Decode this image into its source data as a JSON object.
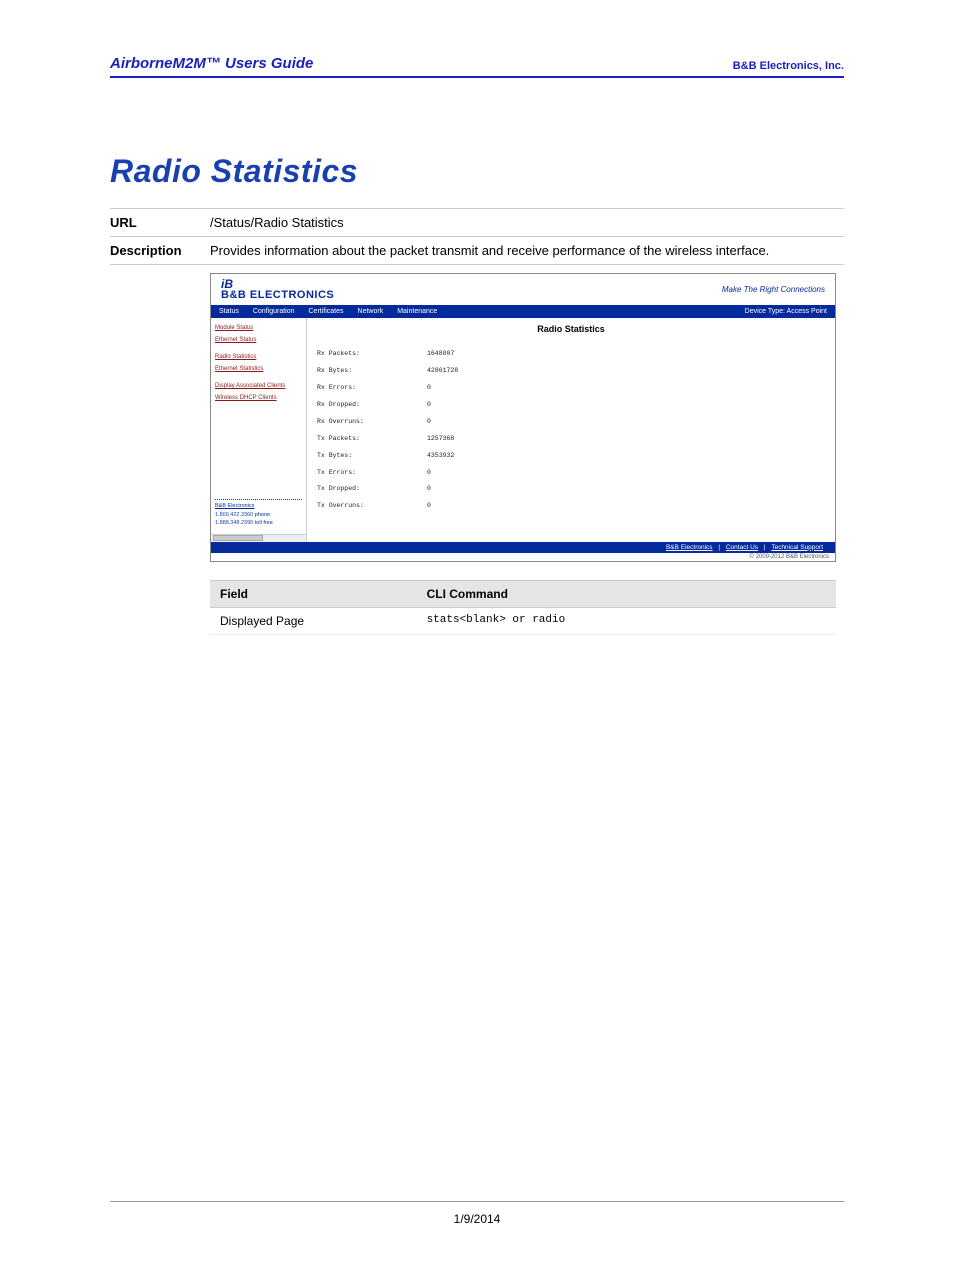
{
  "header": {
    "left": "AirborneM2M™ Users Guide",
    "right": "B&B Electronics, Inc."
  },
  "title": "Radio Statistics",
  "info": {
    "url_label": "URL",
    "url_value": "/Status/Radio Statistics",
    "desc_label": "Description",
    "desc_value": "Provides information about the packet transmit and receive performance of the wireless interface."
  },
  "screenshot": {
    "logo_top": "iB",
    "logo_bot": "B&B ELECTRONICS",
    "tagline": "Make The Right Connections",
    "device_type": "Device Type: Access Point",
    "menu": [
      "Status",
      "Configuration",
      "Certificates",
      "Network",
      "Maintenance"
    ],
    "side_links": [
      "Module Status",
      "Ethernet Status",
      "Radio Statistics",
      "Ethernet Statistics",
      "Display Associated Clients",
      "Wireless DHCP Clients"
    ],
    "side_contact": {
      "company": "B&B Electronics",
      "phone1_num": "1.800.422.3360",
      "phone1_lbl": "phone",
      "phone2_num": "1.888.348.2390",
      "phone2_lbl": "toll free"
    },
    "main_title": "Radio Statistics",
    "stats": [
      {
        "k": "Rx Packets:",
        "v": "1648007"
      },
      {
        "k": "Rx Bytes:",
        "v": "42861728"
      },
      {
        "k": "Rx Errors:",
        "v": "0"
      },
      {
        "k": "Rx Dropped:",
        "v": "0"
      },
      {
        "k": "Rx Overruns:",
        "v": "0"
      },
      {
        "k": "Tx Packets:",
        "v": "1257368"
      },
      {
        "k": "Tx Bytes:",
        "v": "4353932"
      },
      {
        "k": "Tx Errors:",
        "v": "0"
      },
      {
        "k": "Tx Dropped:",
        "v": "0"
      },
      {
        "k": "Tx Overruns:",
        "v": "0"
      }
    ],
    "footer_links": [
      "B&B Electronics",
      "Contact Us",
      "Technical Support"
    ],
    "copyright": "© 2009-2012 B&B Electronics"
  },
  "field_table": {
    "h1": "Field",
    "h2": "CLI Command",
    "r1c1": "Displayed Page",
    "r1c2": "stats<blank> or radio"
  },
  "footer_date": "1/9/2014"
}
